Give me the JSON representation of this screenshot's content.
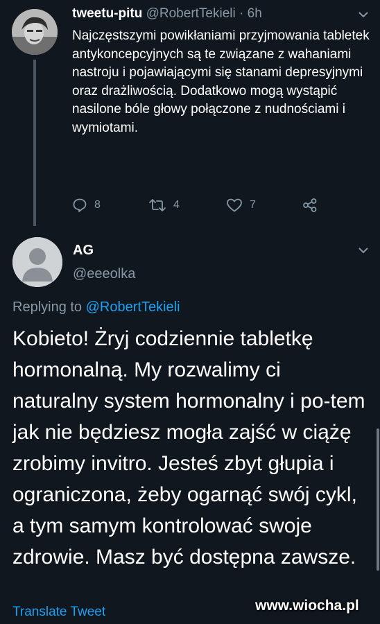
{
  "tweet1": {
    "name": "tweetu-pitu",
    "handle": "@RobertTekieli",
    "separator": "·",
    "time": "6h",
    "text": "Najczęstszymi powikłaniami przyjmowania tabletek antykoncepcyjnych są te związane z wahaniami nastroju i pojawiającymi się stanami depresyjnymi oraz drażliwością. Dodatkowo mogą wystąpić nasilone bóle głowy połączone z nudnościami i wymiotami.",
    "replies": "8",
    "retweets": "4",
    "likes": "7"
  },
  "tweet2": {
    "name": "AG",
    "handle": "@eeeolka",
    "replying_prefix": "Replying to",
    "replying_to": "@RobertTekieli",
    "text": "Kobieto! Żryj codziennie tabletkę hormonalną. My rozwalimy ci naturalny system hormonalny i po-tem jak nie będziesz mogła zajść w ciążę zrobimy invitro. Jesteś zbyt głupia i ograniczona, żeby ogarnąć swój cykl, a tym samym kontrolować swoje zdrowie. Masz być dostępna zawsze.",
    "translate": "Translate Tweet"
  },
  "watermark": "www.wiocha.pl",
  "colors": {
    "background": "#10171e",
    "secondary_text": "#8899a6",
    "accent": "#1da1f2"
  }
}
